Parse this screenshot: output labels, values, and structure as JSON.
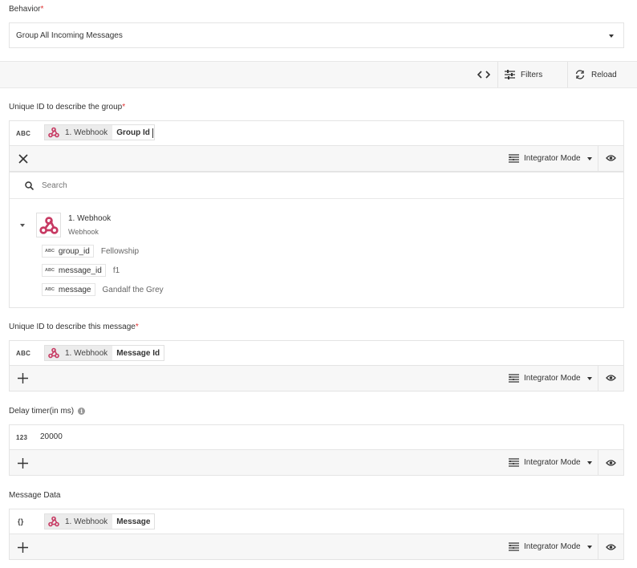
{
  "behavior": {
    "label": "Behavior",
    "required_mark": "*",
    "value": "Group All Incoming Messages"
  },
  "toolbar": {
    "code_icon": "code-icon",
    "filters_label": "Filters",
    "reload_label": "Reload"
  },
  "group_field": {
    "label": "Unique ID to describe the group",
    "required_mark": "*",
    "type_tag": "ABC",
    "source": "1. Webhook",
    "field": "Group Id",
    "mode": "Integrator Mode"
  },
  "picker": {
    "search_placeholder": "Search",
    "node": {
      "name": "1. Webhook",
      "subtitle": "Webhook"
    },
    "fields": [
      {
        "type": "ABC",
        "key": "group_id",
        "value": "Fellowship"
      },
      {
        "type": "ABC",
        "key": "message_id",
        "value": "f1"
      },
      {
        "type": "ABC",
        "key": "message",
        "value": "Gandalf the Grey"
      }
    ]
  },
  "message_field": {
    "label": "Unique ID to describe this message",
    "required_mark": "*",
    "type_tag": "ABC",
    "source": "1. Webhook",
    "field": "Message Id",
    "mode": "Integrator Mode"
  },
  "delay_field": {
    "label": "Delay timer(in ms)",
    "type_tag": "123",
    "value": "20000",
    "mode": "Integrator Mode"
  },
  "data_field": {
    "label": "Message Data",
    "type_tag": "{}",
    "source": "1. Webhook",
    "field": "Message",
    "mode": "Integrator Mode"
  },
  "colors": {
    "required": "#e03131",
    "border": "#e4e4e4",
    "bar_bg": "#f7f7f7",
    "webhook_red": "#c73a63"
  }
}
